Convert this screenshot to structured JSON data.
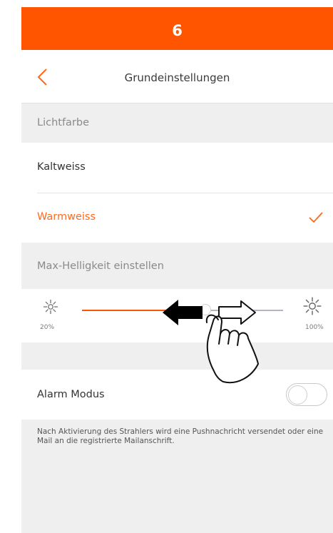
{
  "step": {
    "number": "6"
  },
  "nav": {
    "title": "Grundeinstellungen",
    "back_icon": "chevron-left-icon"
  },
  "light_color": {
    "section_label": "Lichtfarbe",
    "options": [
      {
        "label": "Kaltweiss",
        "selected": false
      },
      {
        "label": "Warmweiss",
        "selected": true
      }
    ]
  },
  "brightness": {
    "section_label": "Max-Helligkeit einstellen",
    "min_label": "20%",
    "max_label": "100%",
    "value_percent": 62
  },
  "alarm": {
    "label": "Alarm Modus",
    "enabled": false
  },
  "info_text": "Nach Aktivierung des Strahlers wird eine Pushnachricht versendet oder eine Mail an die registrierte Mailanschrift.",
  "colors": {
    "accent": "#ff5500",
    "selected_text": "#ff6a1a",
    "background": "#efefef",
    "slider_inactive": "#b5b5c0"
  }
}
